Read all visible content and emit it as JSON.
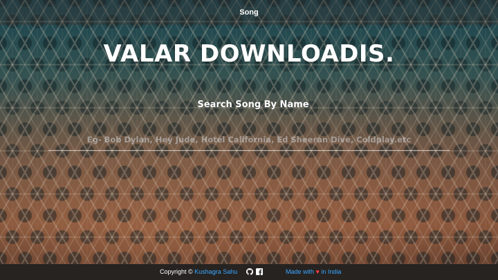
{
  "nav": {
    "song_label": "Song"
  },
  "hero": {
    "title": "VALAR DOWNLOADIS."
  },
  "search": {
    "heading": "Search Song By Name",
    "placeholder": "Eg- Bob Dylan, Hey Jude, Hotel California, Ed Sheeran Dive, Coldplay.etc",
    "value": ""
  },
  "footer": {
    "copyright_prefix": "Copyright ©",
    "author": "Kushagra Sahu",
    "made_prefix": "Made with",
    "heart": "♥",
    "made_suffix": "in India",
    "icons": [
      "github-icon",
      "facebook-icon"
    ]
  },
  "colors": {
    "link": "#3aa7ff",
    "heart": "#ff3b3b",
    "footer_bg": "#262321",
    "teal": "#1f4a55",
    "copper": "#b0704e"
  }
}
